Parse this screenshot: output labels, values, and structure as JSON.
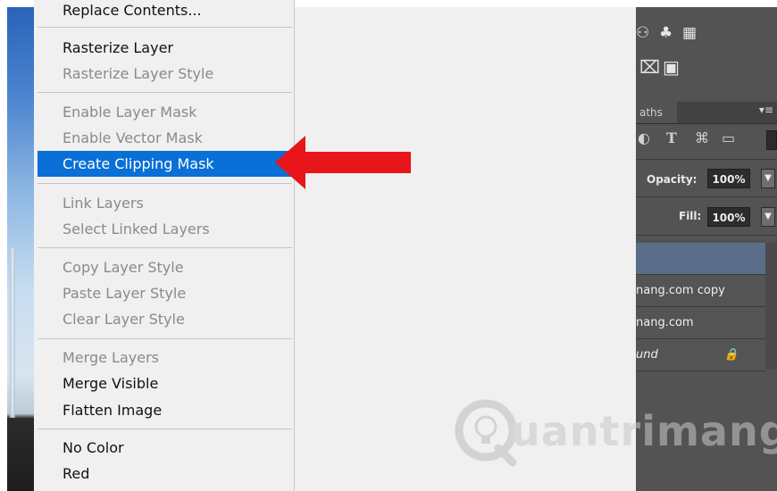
{
  "menu": {
    "items": [
      {
        "label": "Replace Contents...",
        "state": "enabled"
      },
      {
        "label": "Rasterize Layer",
        "state": "enabled"
      },
      {
        "label": "Rasterize Layer Style",
        "state": "disabled"
      },
      {
        "label": "Enable Layer Mask",
        "state": "disabled"
      },
      {
        "label": "Enable Vector Mask",
        "state": "disabled"
      },
      {
        "label": "Create Clipping Mask",
        "state": "highlighted"
      },
      {
        "label": "Link Layers",
        "state": "disabled"
      },
      {
        "label": "Select Linked Layers",
        "state": "disabled"
      },
      {
        "label": "Copy Layer Style",
        "state": "disabled"
      },
      {
        "label": "Paste Layer Style",
        "state": "disabled"
      },
      {
        "label": "Clear Layer Style",
        "state": "disabled"
      },
      {
        "label": "Merge Layers",
        "state": "disabled"
      },
      {
        "label": "Merge Visible",
        "state": "enabled"
      },
      {
        "label": "Flatten Image",
        "state": "enabled"
      },
      {
        "label": "No Color",
        "state": "enabled"
      },
      {
        "label": "Red",
        "state": "enabled"
      }
    ]
  },
  "layers_panel": {
    "tab_label": "aths",
    "opacity_label": "Opacity:",
    "opacity_value": "100%",
    "fill_label": "Fill:",
    "fill_value": "100%",
    "layers": [
      {
        "name": "",
        "selected": true
      },
      {
        "name": "nang.com copy",
        "selected": false
      },
      {
        "name": "nang.com",
        "selected": false
      },
      {
        "name": "und",
        "selected": false,
        "locked": true
      }
    ]
  },
  "watermark": {
    "text": "uantrimang"
  },
  "colors": {
    "highlight": "#0a6fd6",
    "arrow": "#e8161b",
    "panel_bg": "#535353",
    "menu_bg": "#f0f0f0"
  },
  "icons": {
    "panel_row1": [
      "channels-icon",
      "swatches-icon",
      "grid-icon"
    ],
    "panel_row2": [
      "mask-icon",
      "square-icon"
    ],
    "filter": [
      "adjustment-icon",
      "type-icon",
      "transform-icon",
      "smart-object-icon"
    ],
    "lock": "lock-icon",
    "arrow": "red-arrow-icon"
  }
}
